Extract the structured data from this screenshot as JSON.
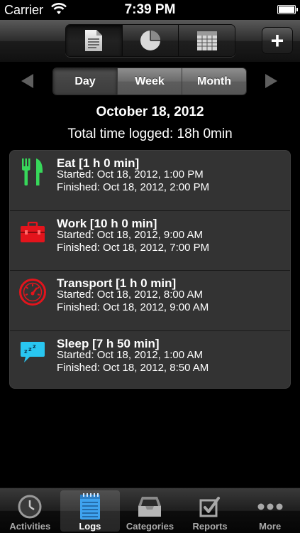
{
  "status_bar": {
    "carrier": "Carrier",
    "time": "7:39 PM"
  },
  "top_toolbar": {
    "views": [
      {
        "icon": "document-icon",
        "active": true
      },
      {
        "icon": "pie-chart-icon",
        "active": false
      },
      {
        "icon": "calendar-icon",
        "active": false
      }
    ],
    "add_label": "+"
  },
  "period": {
    "options": [
      "Day",
      "Week",
      "Month"
    ],
    "selected": "Day"
  },
  "date_title": "October 18, 2012",
  "total_time": "Total time logged: 18h 0min",
  "logs": [
    {
      "title": "Eat [1 h 0 min]",
      "started": "Started: Oct 18, 2012, 1:00 PM",
      "finished": "Finished: Oct 18, 2012, 2:00 PM",
      "icon": "fork-knife-icon",
      "color": "#37d85a"
    },
    {
      "title": "Work [10 h 0 min]",
      "started": "Started: Oct 18, 2012, 9:00 AM",
      "finished": "Finished: Oct 18, 2012, 7:00 PM",
      "icon": "toolbox-icon",
      "color": "#e3141c"
    },
    {
      "title": "Transport [1 h 0 min]",
      "started": "Started: Oct 18, 2012, 8:00 AM",
      "finished": "Finished: Oct 18, 2012, 9:00 AM",
      "icon": "speedometer-icon",
      "color": "#e3141c"
    },
    {
      "title": "Sleep [7 h 50 min]",
      "started": "Started: Oct 18, 2012, 1:00 AM",
      "finished": "Finished: Oct 18, 2012, 8:50 AM",
      "icon": "sleep-bubble-icon",
      "color": "#29c6f0"
    }
  ],
  "tabs": [
    {
      "label": "Activities",
      "icon": "clock-icon",
      "active": false
    },
    {
      "label": "Logs",
      "icon": "notepad-icon",
      "active": true
    },
    {
      "label": "Categories",
      "icon": "inbox-tray-icon",
      "active": false
    },
    {
      "label": "Reports",
      "icon": "checkbox-icon",
      "active": false
    },
    {
      "label": "More",
      "icon": "more-dots-icon",
      "active": false
    }
  ]
}
